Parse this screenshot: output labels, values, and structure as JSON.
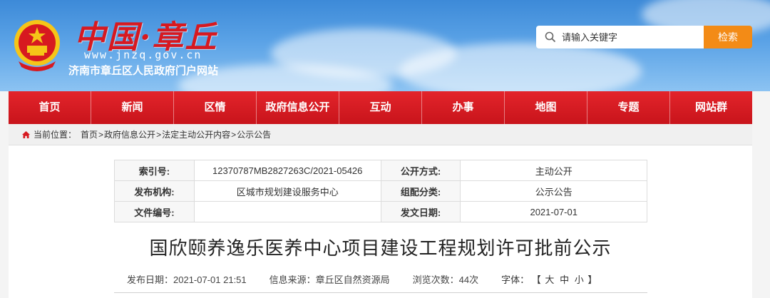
{
  "header": {
    "logo_title": "中国·章丘",
    "logo_url": "www.jnzq.gov.cn",
    "logo_subtitle": "济南市章丘区人民政府门户网站",
    "search_placeholder": "请输入关键字",
    "search_button": "检索"
  },
  "nav": [
    "首页",
    "新闻",
    "区情",
    "政府信息公开",
    "互动",
    "办事",
    "地图",
    "专题",
    "网站群"
  ],
  "breadcrumb": {
    "label": "当前位置：",
    "items": [
      "首页",
      "政府信息公开",
      "法定主动公开内容",
      "公示公告"
    ],
    "separator": ">"
  },
  "meta": {
    "index_no_label": "索引号:",
    "index_no": "12370787MB2827263C/2021-05426",
    "disclosure_label": "公开方式:",
    "disclosure": "主动公开",
    "publisher_label": "发布机构:",
    "publisher": "区城市规划建设服务中心",
    "category_label": "组配分类:",
    "category": "公示公告",
    "doc_no_label": "文件编号:",
    "doc_no": "",
    "issue_date_label": "发文日期:",
    "issue_date": "2021-07-01"
  },
  "article": {
    "title": "国欣颐养逸乐医养中心项目建设工程规划许可批前公示",
    "publish_date": "发布日期：2021-07-01 21:51",
    "source": "信息来源：章丘区自然资源局",
    "views": "浏览次数：44次",
    "font_label": "字体：",
    "font_open": "【",
    "font_large": "大",
    "font_medium": "中",
    "font_small": "小",
    "font_close": "】"
  },
  "colors": {
    "nav_red": "#d71920",
    "search_orange": "#f38b16",
    "sky_blue": "#4a95de"
  }
}
